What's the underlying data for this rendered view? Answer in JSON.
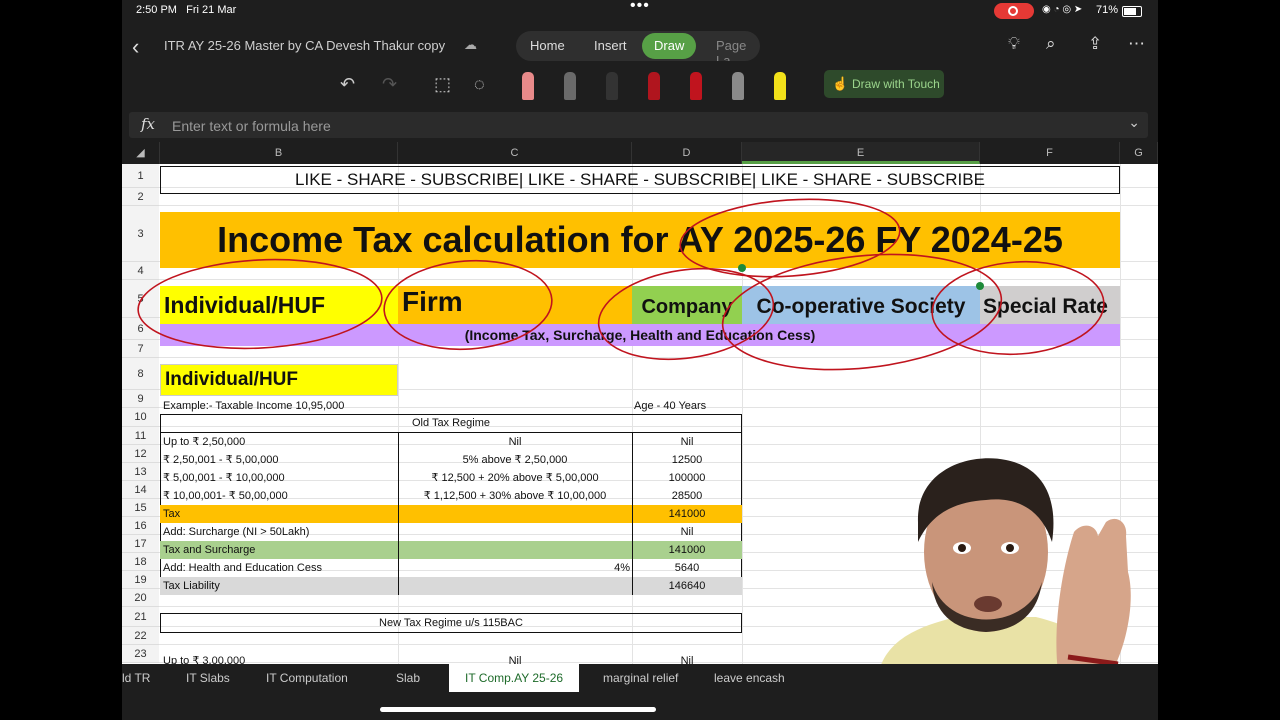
{
  "status": {
    "time": "2:50 PM",
    "date": "Fri 21 Mar",
    "battery": "71%"
  },
  "topbar": {
    "doc_title": "ITR AY 25-26 Master by CA Devesh Thakur copy",
    "tabs": [
      "Home",
      "Insert",
      "Draw",
      "Page La"
    ],
    "active_tab": "Draw"
  },
  "drawbar": {
    "draw_with_touch": "Draw with Touch"
  },
  "formula": {
    "fx": "fx",
    "placeholder": "Enter text or formula here"
  },
  "columns": [
    "B",
    "C",
    "D",
    "E",
    "F",
    "G"
  ],
  "rows": [
    "1",
    "2",
    "3",
    "4",
    "5",
    "6",
    "7",
    "8",
    "9",
    "10",
    "11",
    "12",
    "13",
    "14",
    "15",
    "16",
    "17",
    "18",
    "19",
    "20",
    "21",
    "22",
    "23"
  ],
  "sheet": {
    "banner": "LIKE - SHARE - SUBSCRIBE| LIKE - SHARE - SUBSCRIBE| LIKE - SHARE - SUBSCRIBE",
    "title": "Income Tax calculation for AY 2025-26 FY 2024-25",
    "categories": [
      "Individual/HUF",
      "Firm",
      "Company",
      "Co-operative Society",
      "Special Rate"
    ],
    "subtitle": "(Income Tax, Surcharge, Health and Education Cess)",
    "section": "Individual/HUF",
    "example": "Example:- Taxable Income 10,95,000",
    "age": "Age - 40 Years",
    "old_regime": "Old Tax Regime",
    "slabs": [
      {
        "range": "Up to ₹ 2,50,000",
        "rate": "Nil",
        "tax": "Nil"
      },
      {
        "range": "₹ 2,50,001 - ₹ 5,00,000",
        "rate": "5% above ₹ 2,50,000",
        "tax": "12500"
      },
      {
        "range": "₹ 5,00,001 - ₹ 10,00,000",
        "rate": "₹ 12,500 + 20% above ₹ 5,00,000",
        "tax": "100000"
      },
      {
        "range": "₹ 10,00,001- ₹ 50,00,000",
        "rate": "₹ 1,12,500 + 30% above ₹ 10,00,000",
        "tax": "28500"
      }
    ],
    "tax_label": "Tax",
    "tax_value": "141000",
    "surcharge_label": "Add: Surcharge (NI > 50Lakh)",
    "surcharge_value": "Nil",
    "tax_surcharge_label": "Tax and Surcharge",
    "tax_surcharge_value": "141000",
    "cess_label": "Add: Health and Education Cess",
    "cess_rate": "4%",
    "cess_value": "5640",
    "liability_label": "Tax Liability",
    "liability_value": "146640",
    "new_regime": "New Tax Regime u/s 115BAC",
    "new_slab1": {
      "range": "Up to ₹ 3,00,000",
      "rate": "Nil",
      "tax": "Nil"
    }
  },
  "sheet_tabs": [
    "ld TR",
    "IT Slabs",
    "IT Computation",
    "Slab",
    "IT Comp.AY 25-26",
    "marginal relief",
    "leave encash"
  ],
  "active_sheet": "IT Comp.AY 25-26",
  "colors": {
    "accent": "#57a046",
    "gold": "#ffc000",
    "yellow": "#ffff00",
    "green": "#92d050",
    "blue": "#9dc3e6",
    "grey": "#d0cece",
    "purple": "#cc99ff",
    "ink": "#c0141e"
  }
}
